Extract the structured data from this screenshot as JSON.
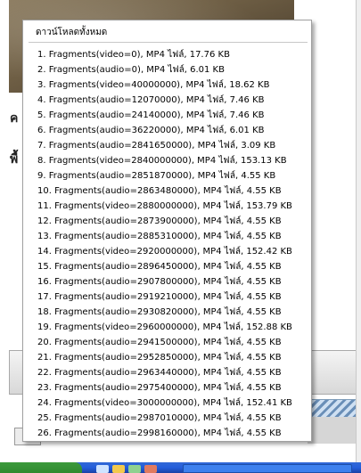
{
  "background": {
    "text_line_1": "ค",
    "text_line_2": "พื้"
  },
  "menu": {
    "title": "ดาวน์โหลดทั้งหมด",
    "items": [
      "1.  Fragments(video=0),  MP4 ไฟล์, 17.76 KB",
      "2.  Fragments(audio=0),  MP4 ไฟล์, 6.01 KB",
      "3.  Fragments(video=40000000),  MP4 ไฟล์, 18.62 KB",
      "4.  Fragments(audio=12070000),  MP4 ไฟล์, 7.46 KB",
      "5.  Fragments(audio=24140000),  MP4 ไฟล์, 7.46 KB",
      "6.  Fragments(audio=36220000),  MP4 ไฟล์, 6.01 KB",
      "7.  Fragments(audio=2841650000),  MP4 ไฟล์, 3.09 KB",
      "8.  Fragments(video=2840000000),  MP4 ไฟล์, 153.13 KB",
      "9.  Fragments(audio=2851870000),  MP4 ไฟล์, 4.55 KB",
      "10.  Fragments(audio=2863480000),  MP4 ไฟล์, 4.55 KB",
      "11.  Fragments(video=2880000000),  MP4 ไฟล์, 153.79 KB",
      "12.  Fragments(audio=2873900000),  MP4 ไฟล์, 4.55 KB",
      "13.  Fragments(audio=2885310000),  MP4 ไฟล์, 4.55 KB",
      "14.  Fragments(video=2920000000),  MP4 ไฟล์, 152.42 KB",
      "15.  Fragments(audio=2896450000),  MP4 ไฟล์, 4.55 KB",
      "16.  Fragments(audio=2907800000),  MP4 ไฟล์, 4.55 KB",
      "17.  Fragments(audio=2919210000),  MP4 ไฟล์, 4.55 KB",
      "18.  Fragments(audio=2930820000),  MP4 ไฟล์, 4.55 KB",
      "19.  Fragments(video=2960000000),  MP4 ไฟล์, 152.88 KB",
      "20.  Fragments(audio=2941500000),  MP4 ไฟล์, 4.55 KB",
      "21.  Fragments(audio=2952850000),  MP4 ไฟล์, 4.55 KB",
      "22.  Fragments(audio=2963440000),  MP4 ไฟล์, 4.55 KB",
      "23.  Fragments(audio=2975400000),  MP4 ไฟล์, 4.55 KB",
      "24.  Fragments(video=3000000000),  MP4 ไฟล์, 152.41 KB",
      "25.  Fragments(audio=2987010000),  MP4 ไฟล์, 4.55 KB",
      "26.  Fragments(audio=2998160000),  MP4 ไฟล์, 4.55 KB"
    ]
  },
  "colors": {
    "taskbar": "#245edb",
    "start_button": "#2f8a2f",
    "menu_border": "#a0a0a0"
  }
}
